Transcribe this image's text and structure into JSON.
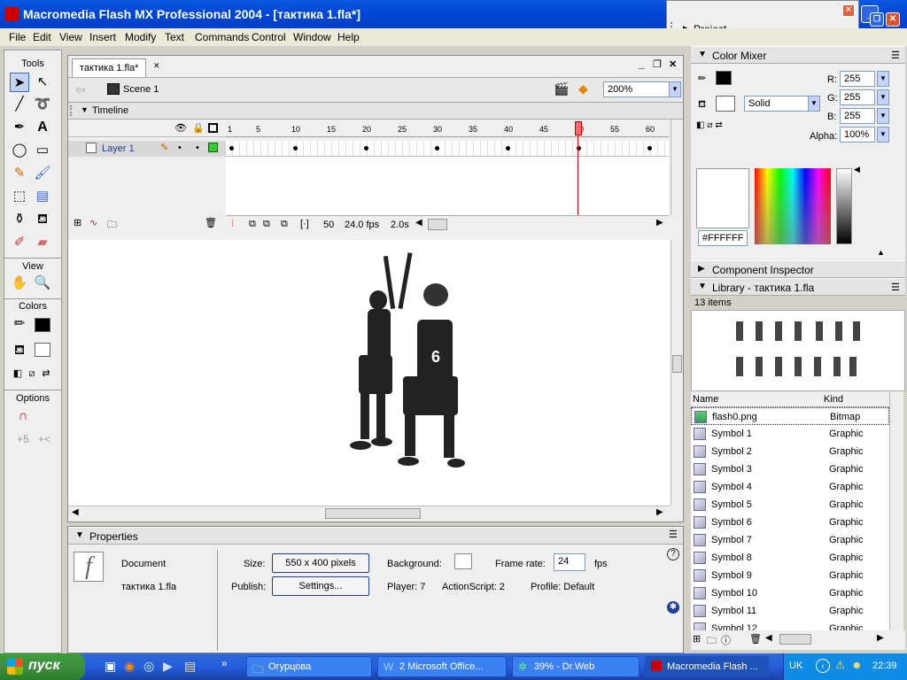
{
  "window": {
    "title": "Macromedia Flash MX Professional 2004 - [тактика 1.fla*]"
  },
  "menu": [
    "File",
    "Edit",
    "View",
    "Insert",
    "Modify",
    "Text",
    "Commands",
    "Control",
    "Window",
    "Help"
  ],
  "toolbox": {
    "tools_label": "Tools",
    "view_label": "View",
    "colors_label": "Colors",
    "options_label": "Options"
  },
  "document": {
    "tab": "тактика 1.fla*",
    "scene": "Scene 1",
    "zoom": "200%",
    "timeline_label": "Timeline",
    "layer_name": "Layer 1",
    "frame_numbers": [
      "1",
      "5",
      "10",
      "15",
      "20",
      "25",
      "30",
      "35",
      "40",
      "45",
      "50",
      "55",
      "60"
    ],
    "current_frame": "50",
    "fps": "24.0 fps",
    "time": "2.0s"
  },
  "properties": {
    "title": "Properties",
    "type": "Document",
    "filename": "тактика 1.fla",
    "size_label": "Size:",
    "size_value": "550 x 400 pixels",
    "publish_label": "Publish:",
    "settings_button": "Settings...",
    "background_label": "Background:",
    "framerate_label": "Frame rate:",
    "framerate_value": "24",
    "fps_unit": "fps",
    "player_text": "Player: 7",
    "actionscript_text": "ActionScript: 2",
    "profile_text": "Profile: Default"
  },
  "project_panel": {
    "title": "Project"
  },
  "color_mixer": {
    "title": "Color Mixer",
    "fill_type": "Solid",
    "r_label": "R:",
    "r": "255",
    "g_label": "G:",
    "g": "255",
    "b_label": "B:",
    "b": "255",
    "alpha_label": "Alpha:",
    "alpha": "100%",
    "hex": "#FFFFFF"
  },
  "component_inspector": {
    "title": "Component Inspector"
  },
  "library": {
    "title": "Library - тактика 1.fla",
    "count": "13 items",
    "col_name": "Name",
    "col_kind": "Kind",
    "items": [
      {
        "name": "flash0.png",
        "kind": "Bitmap"
      },
      {
        "name": "Symbol 1",
        "kind": "Graphic"
      },
      {
        "name": "Symbol 2",
        "kind": "Graphic"
      },
      {
        "name": "Symbol 3",
        "kind": "Graphic"
      },
      {
        "name": "Symbol 4",
        "kind": "Graphic"
      },
      {
        "name": "Symbol 5",
        "kind": "Graphic"
      },
      {
        "name": "Symbol 6",
        "kind": "Graphic"
      },
      {
        "name": "Symbol 7",
        "kind": "Graphic"
      },
      {
        "name": "Symbol 8",
        "kind": "Graphic"
      },
      {
        "name": "Symbol 9",
        "kind": "Graphic"
      },
      {
        "name": "Symbol 10",
        "kind": "Graphic"
      },
      {
        "name": "Symbol 11",
        "kind": "Graphic"
      },
      {
        "name": "Symbol 12",
        "kind": "Graphic"
      }
    ]
  },
  "taskbar": {
    "start": "пуск",
    "tasks": [
      {
        "label": "Огурцова"
      },
      {
        "label": "2 Microsoft Office..."
      },
      {
        "label": "39% - Dr.Web"
      },
      {
        "label": "Macromedia Flash ..."
      }
    ],
    "lang": "UK",
    "clock": "22:39"
  },
  "colors": {
    "accent": "#0046d5",
    "selection": "#316ac5",
    "playhead": "#cc0000",
    "start": "#3f8f3f"
  }
}
